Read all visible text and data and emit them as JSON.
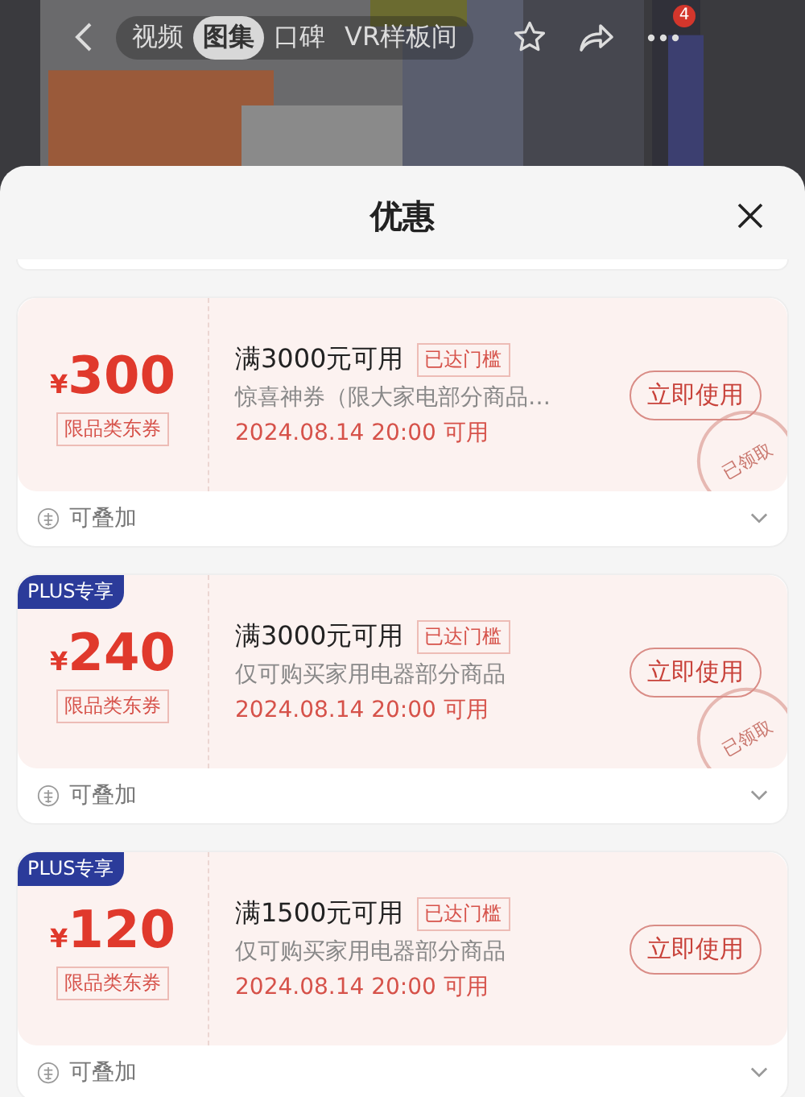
{
  "nav": {
    "tabs": [
      {
        "label": "视频",
        "selected": false
      },
      {
        "label": "图集",
        "selected": true
      },
      {
        "label": "口碑",
        "selected": false
      },
      {
        "label": "VR样板间",
        "selected": false
      }
    ],
    "more_badge": "4"
  },
  "sheet": {
    "title": "优惠"
  },
  "coupons": [
    {
      "currency": "¥",
      "amount": "300",
      "type": "限品类东券",
      "condition": "满3000元可用",
      "badge": "已达门槛",
      "desc": "惊喜神券（限大家电部分商品…",
      "time": "2024.08.14 20:00 可用",
      "button": "立即使用",
      "stamp": "已领取",
      "stack": "可叠加"
    },
    {
      "plus": "PLUS专享",
      "currency": "¥",
      "amount": "240",
      "type": "限品类东券",
      "condition": "满3000元可用",
      "badge": "已达门槛",
      "desc": "仅可购买家用电器部分商品",
      "time": "2024.08.14 20:00 可用",
      "button": "立即使用",
      "stamp": "已领取",
      "stack": "可叠加"
    },
    {
      "plus": "PLUS专享",
      "currency": "¥",
      "amount": "120",
      "type": "限品类东券",
      "condition": "满1500元可用",
      "badge": "已达门槛",
      "desc": "仅可购买家用电器部分商品",
      "time": "2024.08.14 20:00 可用",
      "button": "立即使用",
      "stack": "可叠加"
    }
  ]
}
